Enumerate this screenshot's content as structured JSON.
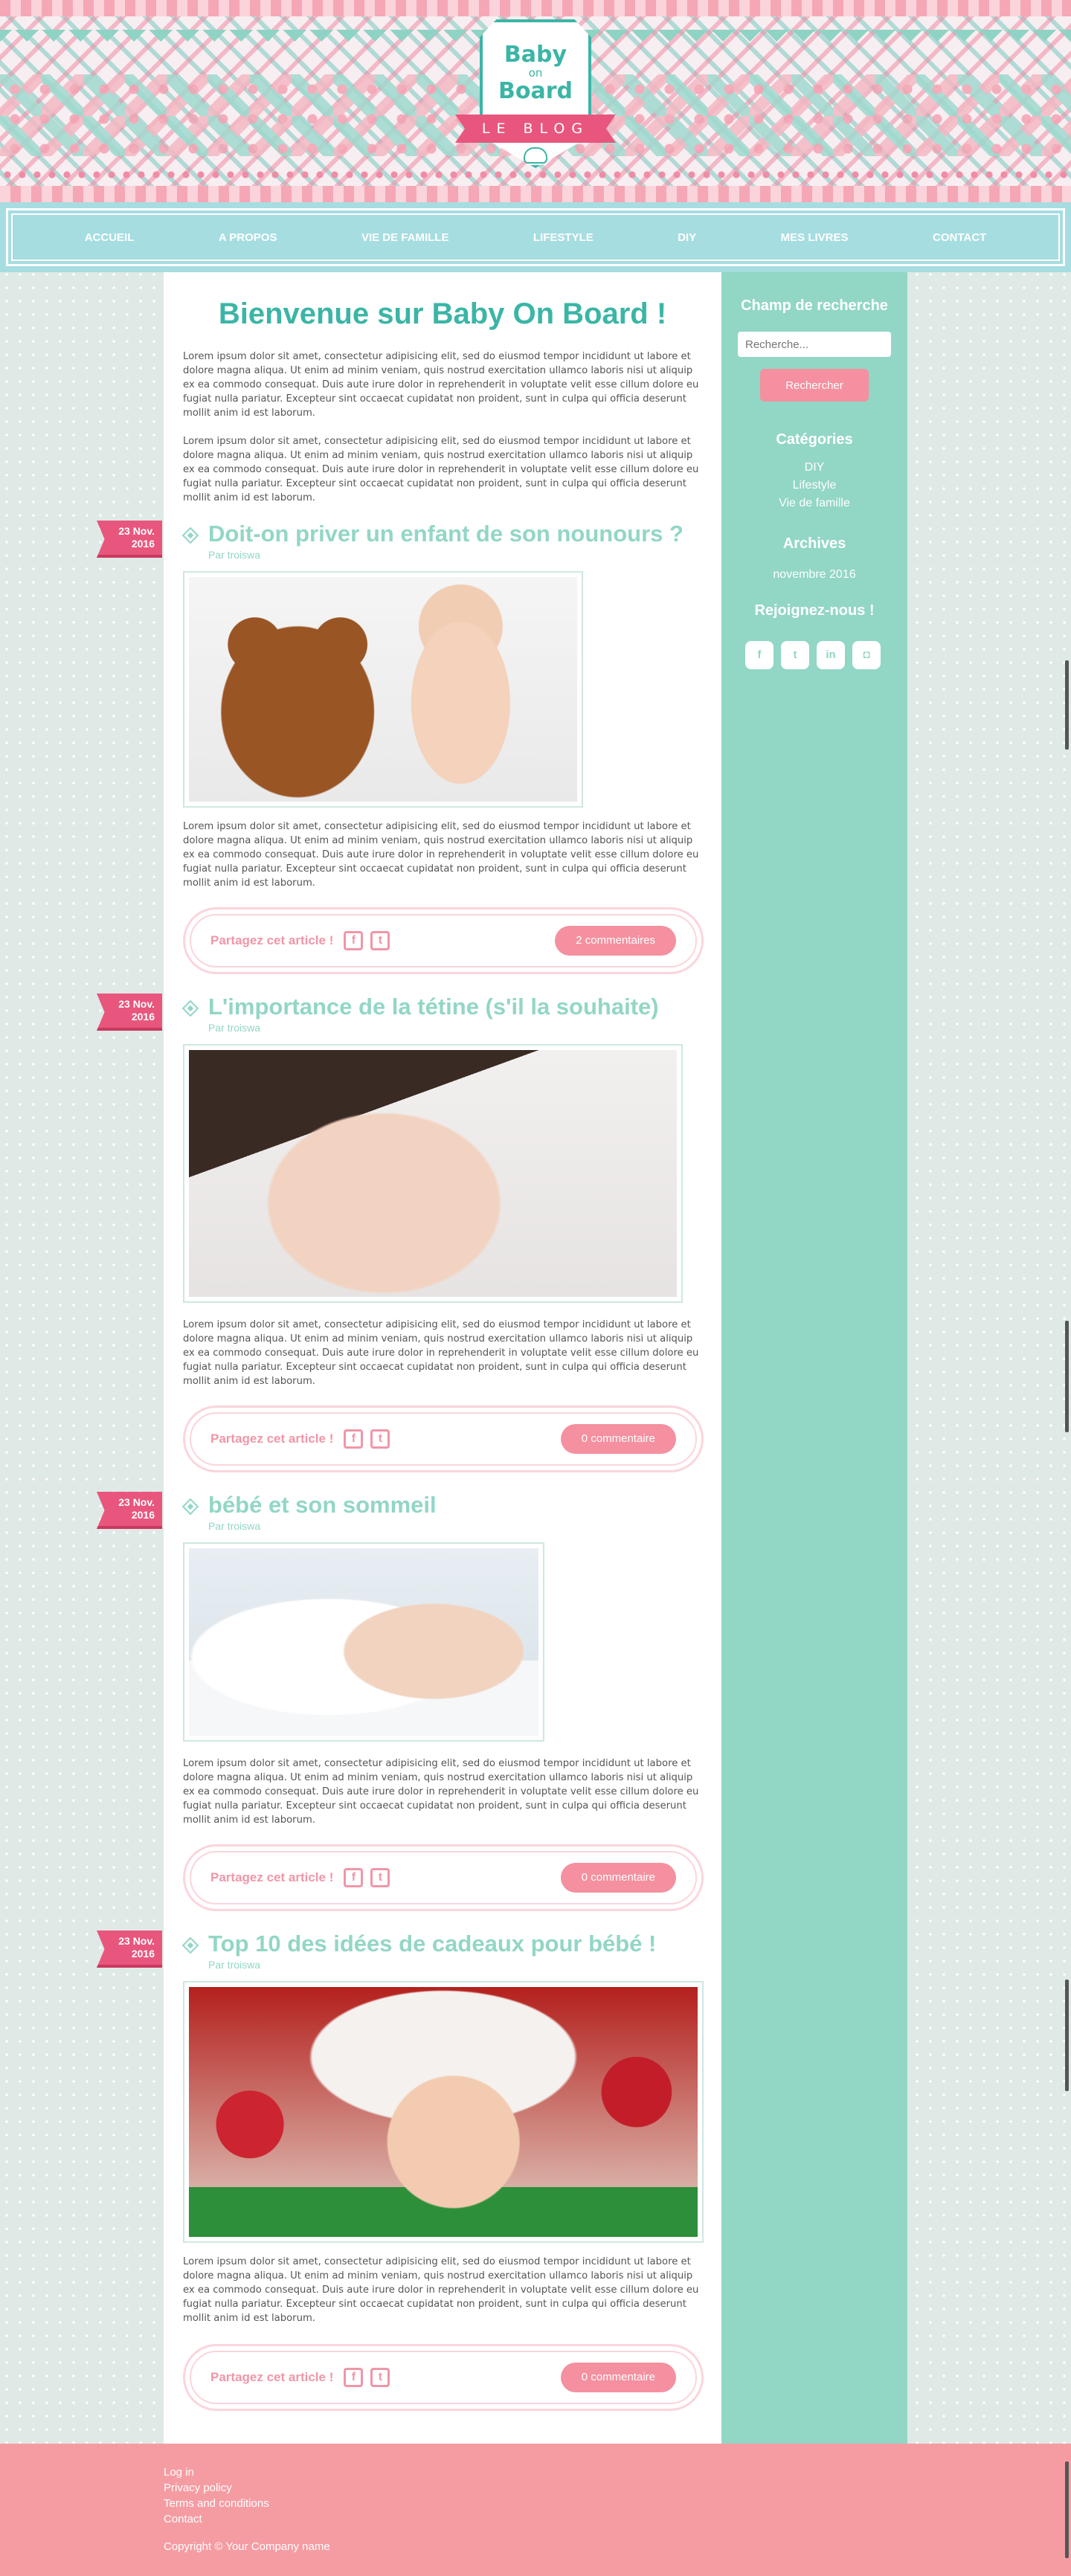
{
  "header": {
    "logo": {
      "line1": "Baby",
      "line2": "on",
      "line3": "Board",
      "ribbon": "LE BLOG"
    }
  },
  "nav": {
    "items": [
      {
        "label": "ACCUEIL"
      },
      {
        "label": "A PROPOS"
      },
      {
        "label": "VIE DE FAMILLE"
      },
      {
        "label": "LIFESTYLE"
      },
      {
        "label": "DIY"
      },
      {
        "label": "MES LIVRES"
      },
      {
        "label": "CONTACT"
      }
    ]
  },
  "main": {
    "welcome_title": "Bienvenue sur Baby On Board !",
    "intro_paragraphs": [
      "Lorem ipsum dolor sit amet, consectetur adipisicing elit, sed do eiusmod tempor incididunt ut labore et dolore magna aliqua. Ut enim ad minim veniam, quis nostrud exercitation ullamco laboris nisi ut aliquip ex ea commodo consequat. Duis aute irure dolor in reprehenderit in voluptate velit esse cillum dolore eu fugiat nulla pariatur. Excepteur sint occaecat cupidatat non proident, sunt in culpa qui officia deserunt mollit anim id est laborum.",
      "Lorem ipsum dolor sit amet, consectetur adipisicing elit, sed do eiusmod tempor incididunt ut labore et dolore magna aliqua. Ut enim ad minim veniam, quis nostrud exercitation ullamco laboris nisi ut aliquip ex ea commodo consequat. Duis aute irure dolor in reprehenderit in voluptate velit esse cillum dolore eu fugiat nulla pariatur. Excepteur sint occaecat cupidatat non proident, sunt in culpa qui officia deserunt mollit anim id est laborum."
    ],
    "posts": [
      {
        "date_day": "23 Nov.",
        "date_year": "2016",
        "title": "Doit-on priver un enfant de son nounours ?",
        "author": "Par troiswa",
        "image": "teddy-bear-and-baby-photo",
        "text": "Lorem ipsum dolor sit amet, consectetur adipisicing elit, sed do eiusmod tempor incididunt ut labore et dolore magna aliqua. Ut enim ad minim veniam, quis nostrud exercitation ullamco laboris nisi ut aliquip ex ea commodo consequat. Duis aute irure dolor in reprehenderit in voluptate velit esse cillum dolore eu fugiat nulla pariatur. Excepteur sint occaecat cupidatat non proident, sunt in culpa qui officia deserunt mollit anim id est laborum.",
        "share_label": "Partagez cet article !",
        "comments": "2 commentaires"
      },
      {
        "date_day": "23 Nov.",
        "date_year": "2016",
        "title": "L'importance de la tétine (s'il la souhaite)",
        "author": "Par troiswa",
        "image": "baby-with-pacifier-photo",
        "text": "Lorem ipsum dolor sit amet, consectetur adipisicing elit, sed do eiusmod tempor incididunt ut labore et dolore magna aliqua. Ut enim ad minim veniam, quis nostrud exercitation ullamco laboris nisi ut aliquip ex ea commodo consequat. Duis aute irure dolor in reprehenderit in voluptate velit esse cillum dolore eu fugiat nulla pariatur. Excepteur sint occaecat cupidatat non proident, sunt in culpa qui officia deserunt mollit anim id est laborum.",
        "share_label": "Partagez cet article !",
        "comments": "0 commentaire"
      },
      {
        "date_day": "23 Nov.",
        "date_year": "2016",
        "title": "bébé et son sommeil",
        "author": "Par troiswa",
        "image": "sleeping-baby-photo",
        "text": "Lorem ipsum dolor sit amet, consectetur adipisicing elit, sed do eiusmod tempor incididunt ut labore et dolore magna aliqua. Ut enim ad minim veniam, quis nostrud exercitation ullamco laboris nisi ut aliquip ex ea commodo consequat. Duis aute irure dolor in reprehenderit in voluptate velit esse cillum dolore eu fugiat nulla pariatur. Excepteur sint occaecat cupidatat non proident, sunt in culpa qui officia deserunt mollit anim id est laborum.",
        "share_label": "Partagez cet article !",
        "comments": "0 commentaire"
      },
      {
        "date_day": "23 Nov.",
        "date_year": "2016",
        "title": "Top 10 des idées de cadeaux pour bébé !",
        "author": "Par troiswa",
        "image": "christmas-baby-photo",
        "text": "Lorem ipsum dolor sit amet, consectetur adipisicing elit, sed do eiusmod tempor incididunt ut labore et dolore magna aliqua. Ut enim ad minim veniam, quis nostrud exercitation ullamco laboris nisi ut aliquip ex ea commodo consequat. Duis aute irure dolor in reprehenderit in voluptate velit esse cillum dolore eu fugiat nulla pariatur. Excepteur sint occaecat cupidatat non proident, sunt in culpa qui officia deserunt mollit anim id est laborum.",
        "share_label": "Partagez cet article !",
        "comments": "0 commentaire"
      }
    ]
  },
  "sidebar": {
    "search_title": "Champ de recherche",
    "search_placeholder": "Recherche...",
    "search_button": "Rechercher",
    "categories_title": "Catégories",
    "categories": [
      "DIY",
      "Lifestyle",
      "Vie de famille"
    ],
    "archives_title": "Archives",
    "archives": [
      "novembre 2016"
    ],
    "join_title": "Rejoignez-nous !",
    "socials": [
      {
        "icon": "facebook-icon",
        "glyph": "f"
      },
      {
        "icon": "twitter-icon",
        "glyph": "t"
      },
      {
        "icon": "linkedin-icon",
        "glyph": "in"
      },
      {
        "icon": "instagram-icon",
        "glyph": "◘"
      }
    ]
  },
  "footer": {
    "links": [
      "Log in",
      "Privacy policy",
      "Terms and conditions",
      "Contact"
    ],
    "copyright": "Copyright © Your Company name"
  },
  "colors": {
    "teal": "#3bb5a6",
    "mint": "#92d6c6",
    "pink": "#e8567d",
    "salmon": "#f59ca3",
    "nav_blue": "#a6dde1"
  }
}
